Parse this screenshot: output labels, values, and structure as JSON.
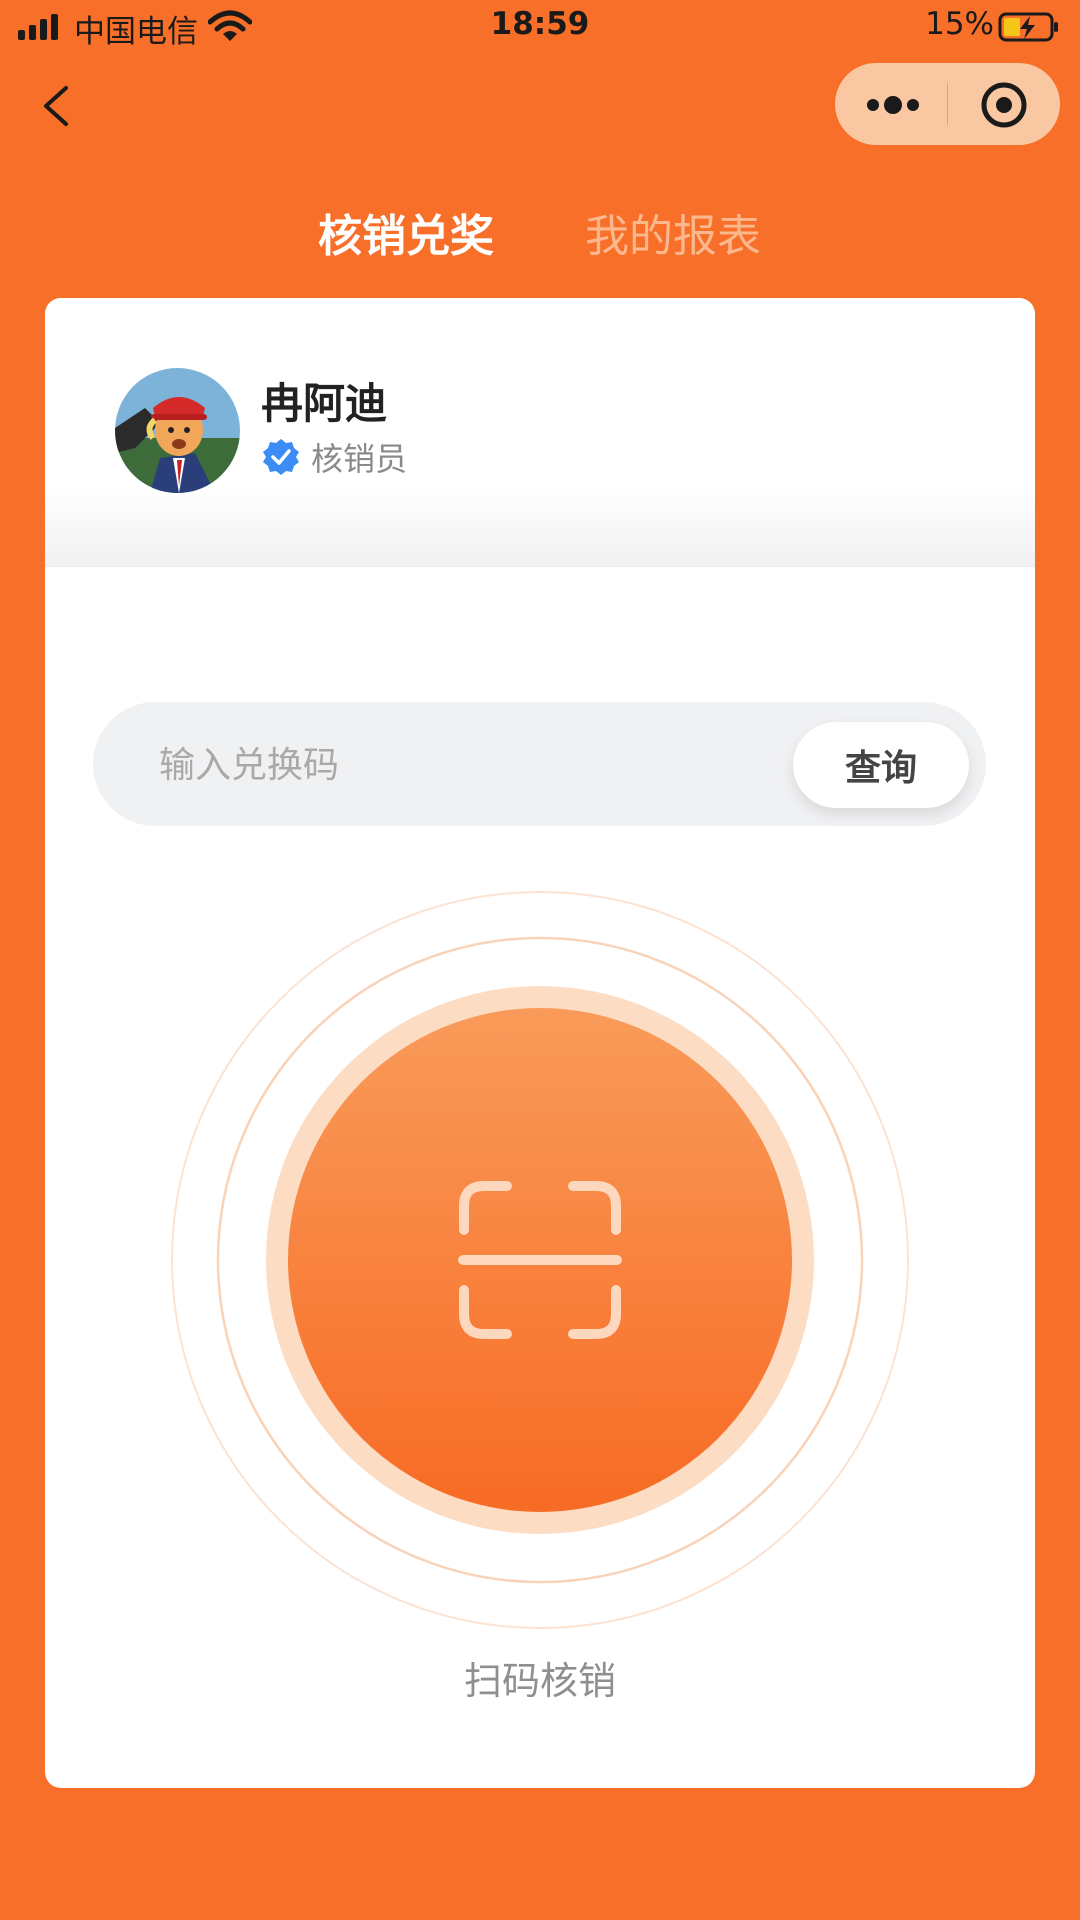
{
  "status_bar": {
    "carrier": "中国电信",
    "time": "18:59",
    "battery_percent": "15%",
    "icons": [
      "signal-icon",
      "wifi-icon",
      "battery-charging-icon"
    ]
  },
  "nav": {
    "back_icon": "chevron-left-icon",
    "capsule_icons": [
      "more-dots-icon",
      "target-icon"
    ]
  },
  "tabs": [
    {
      "label": "核销兑奖",
      "active": true
    },
    {
      "label": "我的报表",
      "active": false
    }
  ],
  "profile": {
    "name": "冉阿迪",
    "role": "核销员",
    "verified_icon": "verified-check-icon"
  },
  "search": {
    "placeholder": "输入兑换码",
    "value": "",
    "button_label": "查询"
  },
  "scan": {
    "icon": "scan-icon",
    "label": "扫码核销"
  },
  "colors": {
    "background": "#F76F28",
    "accent": "#F7742B",
    "verified": "#3B8CF5",
    "tab_inactive": "#FBB88E"
  }
}
